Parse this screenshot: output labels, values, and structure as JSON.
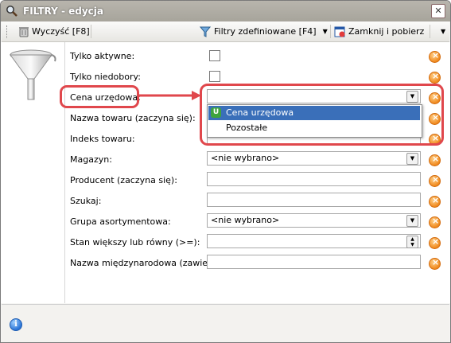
{
  "window": {
    "title": "FILTRY - edycja"
  },
  "toolbar": {
    "clear_label": "Wyczyść [F8]",
    "filters_label": "Filtry zdefiniowane [F4]",
    "close_label": "Zamknij i pobierz"
  },
  "fields": {
    "tylko_aktywne": "Tylko aktywne:",
    "tylko_niedobory": "Tylko niedobory:",
    "cena_urzedowa": "Cena urzędowa:",
    "nazwa_towaru": "Nazwa towaru (zaczyna się):",
    "indeks_towaru": "Indeks towaru:",
    "magazyn": "Magazyn:",
    "magazyn_value": "<nie wybrano>",
    "producent": "Producent (zaczyna się):",
    "szukaj": "Szukaj:",
    "grupa": "Grupa asortymentowa:",
    "grupa_value": "<nie wybrano>",
    "stan": "Stan większy lub równy (>=):",
    "nazwa_miedzy": "Nazwa międzynarodowa (zawiera):"
  },
  "dropdown": {
    "options": [
      "Cena urzędowa",
      "Pozostałe"
    ],
    "selected_badge": "U"
  },
  "colors": {
    "highlight": "#e0474c",
    "selection": "#3a6fb9",
    "clear_icon": "#f08a1e"
  }
}
